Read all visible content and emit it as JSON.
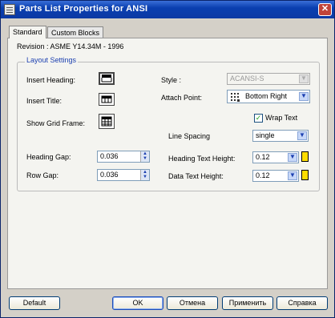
{
  "window": {
    "title": "Parts List Properties for ANSI",
    "close_glyph": "✕"
  },
  "tabs": [
    {
      "label": "Standard"
    },
    {
      "label": "Custom Blocks"
    }
  ],
  "revision": "Revision : ASME Y14.34M - 1996",
  "layout_settings": {
    "title": "Layout Settings",
    "insert_heading": "Insert Heading:",
    "insert_title": "Insert Title:",
    "show_grid_frame": "Show Grid Frame:",
    "style_label": "Style :",
    "style_value": "ACANSI-S",
    "attach_point_label": "Attach Point:",
    "attach_point_value": "Bottom Right",
    "wrap_text_label": "Wrap Text",
    "wrap_text_checked": true,
    "line_spacing_label": "Line Spacing",
    "line_spacing_value": "single",
    "heading_gap_label": "Heading Gap:",
    "heading_gap_value": "0.036",
    "row_gap_label": "Row Gap:",
    "row_gap_value": "0.036",
    "heading_text_height_label": "Heading Text Height:",
    "heading_text_height_value": "0.12",
    "data_text_height_label": "Data Text Height:",
    "data_text_height_value": "0.12",
    "color_swatch": "#ffdd00"
  },
  "buttons": {
    "default": "Default",
    "ok": "OK",
    "cancel": "Отмена",
    "apply": "Применить",
    "help": "Справка"
  }
}
